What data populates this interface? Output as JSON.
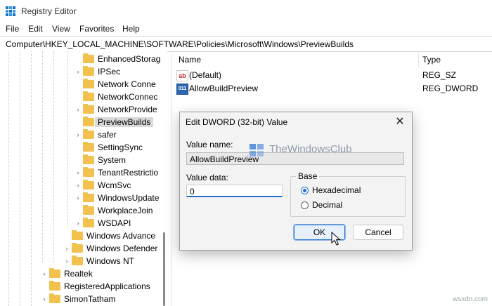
{
  "window": {
    "title": "Registry Editor"
  },
  "menu": [
    "File",
    "Edit",
    "View",
    "Favorites",
    "Help"
  ],
  "address": "Computer\\HKEY_LOCAL_MACHINE\\SOFTWARE\\Policies\\Microsoft\\Windows\\PreviewBuilds",
  "tree": [
    {
      "label": "EnhancedStorag",
      "expander": false
    },
    {
      "label": "IPSec",
      "expander": true
    },
    {
      "label": "Network Conne",
      "expander": false
    },
    {
      "label": "NetworkConnec",
      "expander": false
    },
    {
      "label": "NetworkProvide",
      "expander": true
    },
    {
      "label": "PreviewBuilds",
      "expander": false,
      "selected": true
    },
    {
      "label": "safer",
      "expander": true
    },
    {
      "label": "SettingSync",
      "expander": false
    },
    {
      "label": "System",
      "expander": false
    },
    {
      "label": "TenantRestrictio",
      "expander": true
    },
    {
      "label": "WcmSvc",
      "expander": true
    },
    {
      "label": "WindowsUpdate",
      "expander": true
    },
    {
      "label": "WorkplaceJoin",
      "expander": false
    },
    {
      "label": "WSDAPI",
      "expander": true
    },
    {
      "label": "Windows Advance",
      "expander": false
    },
    {
      "label": "Windows Defender",
      "expander": true
    },
    {
      "label": "Windows NT",
      "expander": true
    },
    {
      "label": "Realtek",
      "expander": true
    },
    {
      "label": "RegisteredApplications",
      "expander": false
    },
    {
      "label": "SimonTatham",
      "expander": true
    }
  ],
  "list": {
    "headers": {
      "name": "Name",
      "type": "Type"
    },
    "rows": [
      {
        "icon": "string-value-icon",
        "icon_text": "ab",
        "name": "(Default)",
        "type": "REG_SZ"
      },
      {
        "icon": "dword-value-icon",
        "icon_text": "011",
        "name": "AllowBuildPreview",
        "type": "REG_DWORD"
      }
    ]
  },
  "dialog": {
    "title": "Edit DWORD (32-bit) Value",
    "close": "✕",
    "value_name_label": "Value name:",
    "value_name": "AllowBuildPreview",
    "value_data_label": "Value data:",
    "value_data": "0",
    "base_label": "Base",
    "hex_label": "Hexadecimal",
    "dec_label": "Decimal",
    "selected_base": "Hexadecimal",
    "ok": "OK",
    "cancel": "Cancel"
  },
  "watermark": "TheWindowsClub",
  "credit": "wsxdn.com"
}
